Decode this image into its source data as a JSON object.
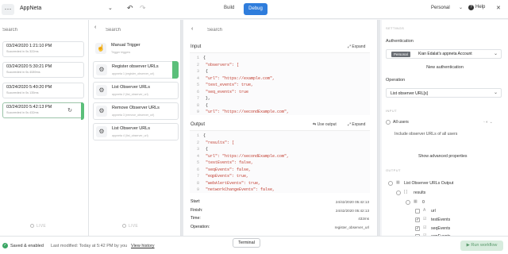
{
  "topbar": {
    "menu_icon": "more-dots-icon",
    "app_title": "AppNeta",
    "tab_build": "Build",
    "tab_debug": "Debug",
    "account": "Personal",
    "help": "Help",
    "accent": "#2f7ddc"
  },
  "runs": {
    "search_placeholder": "Search",
    "items": [
      {
        "time": "03/24/2020 1:21:10 PM",
        "status": "Succeeded in 0s 322ms"
      },
      {
        "time": "03/24/2020 5:30:21 PM",
        "status": "Succeeded in 0s 4089ms"
      },
      {
        "time": "03/24/2020 5:40:20 PM",
        "status": "Succeeded in 0s 135ms"
      },
      {
        "time": "03/24/2020 5:42:13 PM",
        "status": "Succeeded in 0s 432ms"
      }
    ],
    "live": "LIVE"
  },
  "steps": {
    "search_placeholder": "Search",
    "items": [
      {
        "title": "Manual Trigger",
        "subtitle": "Trigger triggers",
        "icon": "trigger-icon"
      },
      {
        "title": "Register observer URLs",
        "subtitle": "appneta 1 (register_observer_url)",
        "icon": "appneta-icon"
      },
      {
        "title": "List Observer URLs",
        "subtitle": "appneta 2 (list_observer_url)",
        "icon": "appneta-icon"
      },
      {
        "title": "Remove Observer URLs",
        "subtitle": "appneta 3 (remove_observer_url)",
        "icon": "appneta-icon"
      },
      {
        "title": "List Observer URLs",
        "subtitle": "appneta 4 (list_observer_url)",
        "icon": "appneta-icon"
      }
    ],
    "live": "LIVE"
  },
  "detail": {
    "search_placeholder": "Search",
    "input_title": "Input",
    "input_action": "Expand",
    "input_lines": [
      {
        "n": "1",
        "t": "{"
      },
      {
        "n": "2",
        "t": "  \"observers\": ["
      },
      {
        "n": "3",
        "t": "    {"
      },
      {
        "n": "4",
        "t": "      \"url\": \"https://example.com\","
      },
      {
        "n": "5",
        "t": "      \"test_events\": true,"
      },
      {
        "n": "6",
        "t": "      \"seq_events\": true"
      },
      {
        "n": "7",
        "t": "    },"
      },
      {
        "n": "8",
        "t": "    {"
      },
      {
        "n": "9",
        "t": "      \"url\": \"https://secondExample.com\","
      }
    ],
    "output_title": "Output",
    "output_action_use": "Use output",
    "output_action_expand": "Expand",
    "output_lines": [
      {
        "n": "1",
        "t": "{"
      },
      {
        "n": "2",
        "t": "  \"results\": ["
      },
      {
        "n": "3",
        "t": "    {"
      },
      {
        "n": "4",
        "t": "      \"url\": \"https://secondExample.com\","
      },
      {
        "n": "5",
        "t": "      \"testEvents\": false,"
      },
      {
        "n": "6",
        "t": "      \"seqEvents\": false,"
      },
      {
        "n": "7",
        "t": "      \"eqpEvents\": true,"
      },
      {
        "n": "8",
        "t": "      \"webAlertEvents\": true,"
      },
      {
        "n": "9",
        "t": "      \"networkChangeEvents\": false,"
      }
    ],
    "meta": [
      {
        "label": "Start:",
        "value": "24/42/2020 05:42:13"
      },
      {
        "label": "Finish:",
        "value": "24/42/2020 05:42:13"
      },
      {
        "label": "Time:",
        "value": "432ms"
      },
      {
        "label": "Operation:",
        "value": "register_observer_url"
      }
    ]
  },
  "settings": {
    "section": "SETTINGS",
    "auth_label": "Authentication",
    "auth_tag": "Personal",
    "auth_value": "Kian Edalat's appneta Account",
    "new_auth": "New authentication",
    "operation_label": "Operation",
    "operation_value": "List observer URL[s]",
    "input_section": "INPUT",
    "all_users": "All users",
    "include_text": "Include observer URLs of all users",
    "advanced": "Show advanced properties",
    "output_section": "OUTPUT",
    "output_tree": [
      {
        "label": "List Observer URLs Output",
        "level": 0
      },
      {
        "label": "results",
        "level": 1
      },
      {
        "label": "0",
        "level": 2
      },
      {
        "label": "url",
        "level": 3
      },
      {
        "label": "testEvents",
        "level": 3
      },
      {
        "label": "seqEvents",
        "level": 3
      },
      {
        "label": "eqpEvents",
        "level": 3
      }
    ]
  },
  "bottombar": {
    "saved": "Saved & enabled",
    "last_modified": "Last modified: Today at 5:42 PM by you",
    "view_history": "View history",
    "terminal": "Terminal",
    "run_workflow": "Run workflow",
    "success_color": "#3aa664"
  }
}
